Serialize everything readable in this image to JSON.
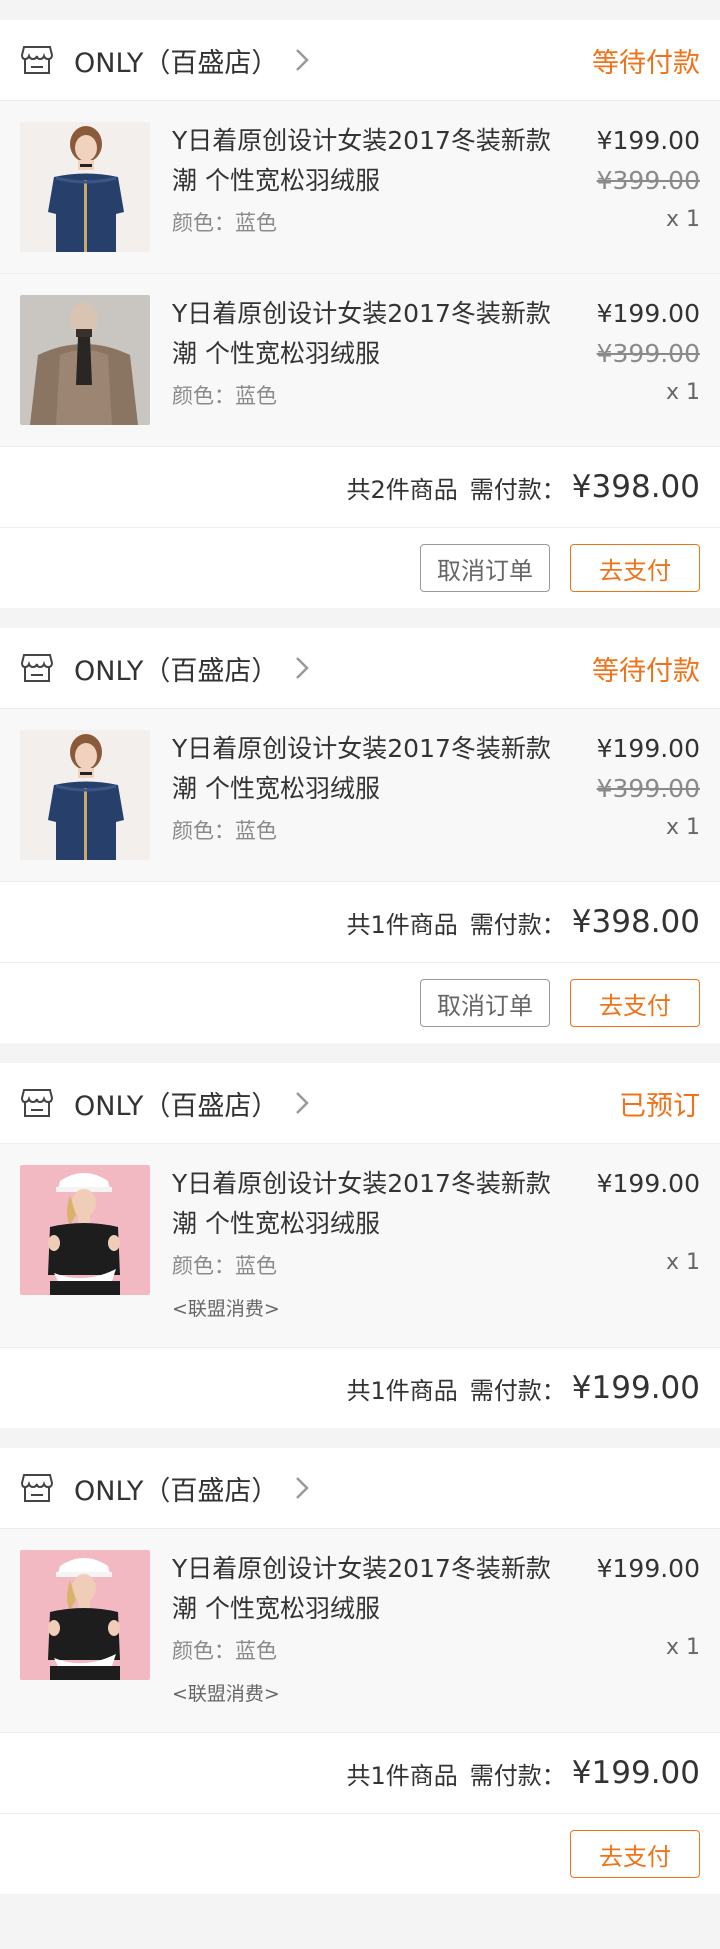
{
  "orders": [
    {
      "shop": "ONLY（百盛店）",
      "status": "等待付款",
      "items": [
        {
          "title": "Y日着原创设计女装2017冬装新款潮 个性宽松羽绒服",
          "spec": "颜色：蓝色",
          "price": "¥199.00",
          "old_price": "¥399.00",
          "qty": "x 1",
          "image": "denim-offshoulder-dress"
        },
        {
          "title": "Y日着原创设计女装2017冬装新款潮 个性宽松羽绒服",
          "spec": "颜色：蓝色",
          "price": "¥199.00",
          "old_price": "¥399.00",
          "qty": "x 1",
          "image": "fur-coat"
        }
      ],
      "count": "共2件商品",
      "pay_label": "需付款：",
      "amount": "¥398.00",
      "cancel_label": "取消订单",
      "pay_button": "去支付"
    },
    {
      "shop": "ONLY（百盛店）",
      "status": "等待付款",
      "items": [
        {
          "title": "Y日着原创设计女装2017冬装新款潮 个性宽松羽绒服",
          "spec": "颜色：蓝色",
          "price": "¥199.00",
          "old_price": "¥399.00",
          "qty": "x 1",
          "image": "denim-offshoulder-dress"
        }
      ],
      "count": "共1件商品",
      "pay_label": "需付款：",
      "amount": "¥398.00",
      "cancel_label": "取消订单",
      "pay_button": "去支付"
    },
    {
      "shop": "ONLY（百盛店）",
      "status": "已预订",
      "items": [
        {
          "title": "Y日着原创设计女装2017冬装新款潮 个性宽松羽绒服",
          "spec": "颜色：蓝色",
          "price": "¥199.00",
          "qty": "x 1",
          "tag": "<联盟消费>",
          "image": "black-top-pink"
        }
      ],
      "count": "共1件商品",
      "pay_label": "需付款：",
      "amount": "¥199.00"
    },
    {
      "shop": "ONLY（百盛店）",
      "status": "",
      "items": [
        {
          "title": "Y日着原创设计女装2017冬装新款潮 个性宽松羽绒服",
          "spec": "颜色：蓝色",
          "price": "¥199.00",
          "qty": "x 1",
          "tag": "<联盟消费>",
          "image": "black-top-pink"
        }
      ],
      "count": "共1件商品",
      "pay_label": "需付款：",
      "amount": "¥199.00",
      "pay_button": "去支付"
    }
  ],
  "colors": {
    "accent": "#f07319",
    "page_bg": "#f4f4f4",
    "item_bg": "#f8f8f8"
  },
  "icons": {
    "shop": "store-icon",
    "chevron": "chevron-right-icon"
  }
}
